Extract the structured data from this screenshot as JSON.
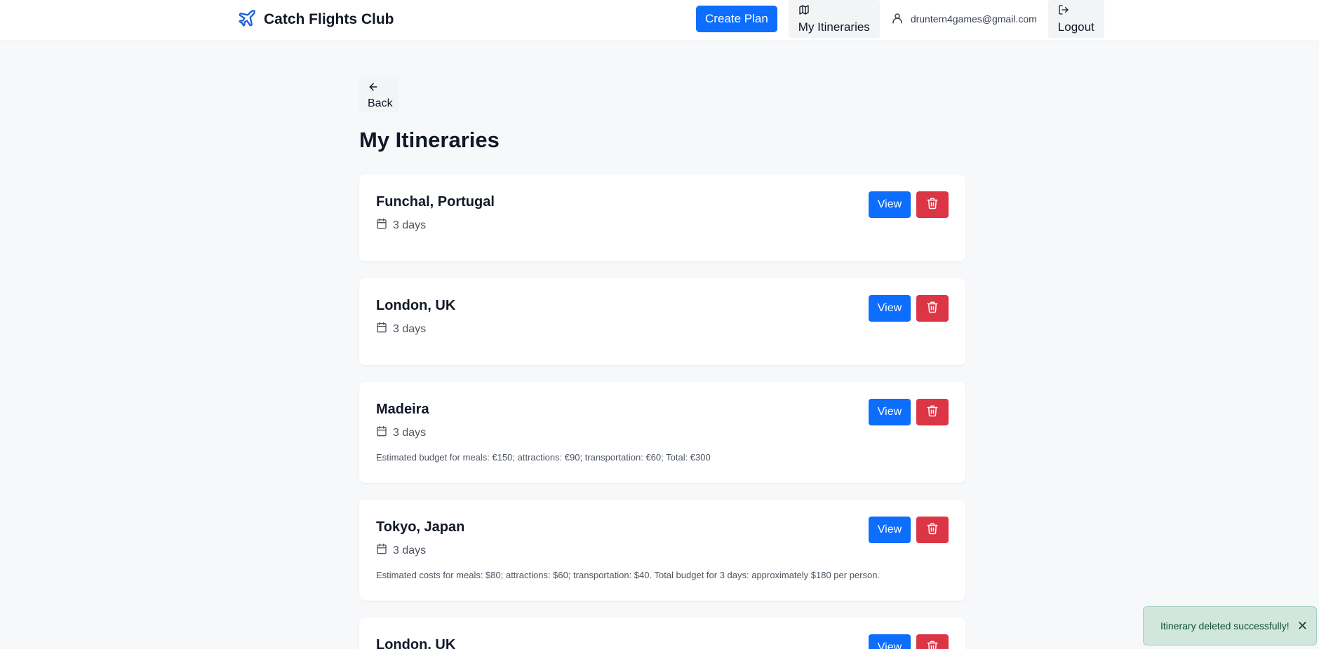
{
  "header": {
    "brand_name": "Catch Flights Club",
    "create_plan_label": "Create Plan",
    "my_itineraries_label": "My Itineraries",
    "user_email": "druntern4games@gmail.com",
    "logout_label": "Logout"
  },
  "main": {
    "back_label": "Back",
    "page_title": "My Itineraries",
    "itineraries": [
      {
        "title": "Funchal, Portugal",
        "duration": "3 days",
        "description": ""
      },
      {
        "title": "London, UK",
        "duration": "3 days",
        "description": ""
      },
      {
        "title": "Madeira",
        "duration": "3 days",
        "description": "Estimated budget for meals: €150; attractions: €90; transportation: €60; Total: €300"
      },
      {
        "title": "Tokyo, Japan",
        "duration": "3 days",
        "description": "Estimated costs for meals: $80; attractions: $60; transportation: $40. Total budget for 3 days: approximately $180 per person."
      },
      {
        "title": "London, UK",
        "duration": "",
        "description": ""
      }
    ],
    "view_label": "View"
  },
  "toast": {
    "message": "Itinerary deleted successfully!",
    "close_symbol": "✕"
  },
  "colors": {
    "primary": "#0d6efd",
    "danger": "#dc3545",
    "success_bg": "#d1e7dd",
    "brand_icon": "#1d5fd6"
  },
  "icons": {
    "brand": "airplane-icon",
    "nav_itineraries": "map-icon",
    "user": "user-icon",
    "logout": "logout-icon",
    "back": "arrow-left-icon",
    "duration": "calendar-icon",
    "delete": "trash-icon"
  }
}
